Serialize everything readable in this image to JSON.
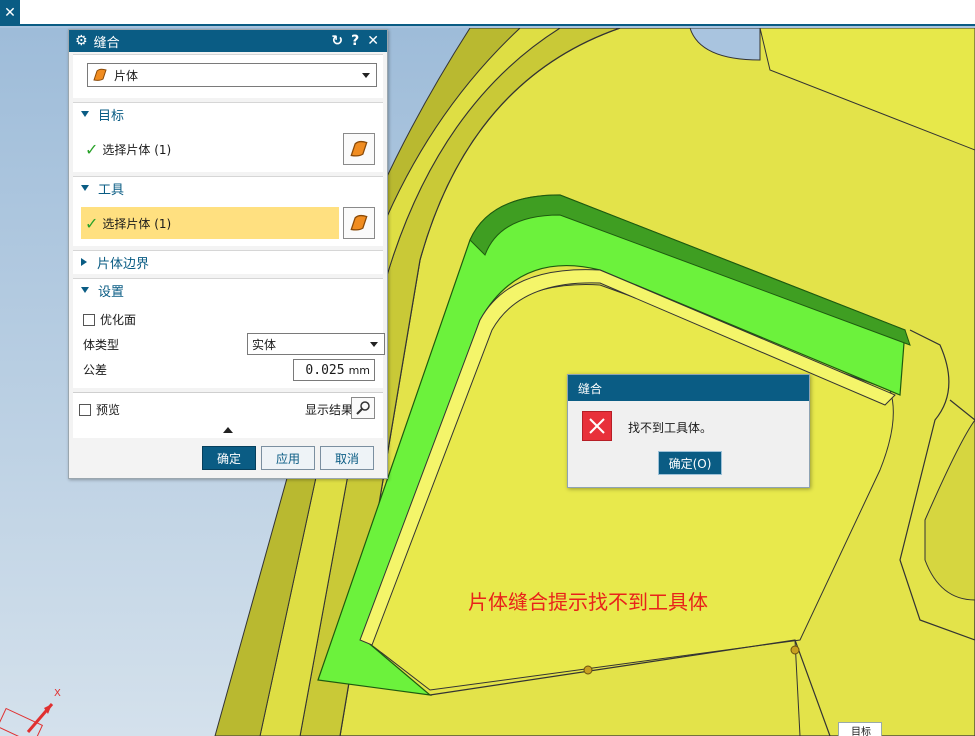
{
  "topbar": {
    "close_glyph": "✕"
  },
  "annotation": "片体缝合提示找不到工具体",
  "stitch_dialog": {
    "title": "缝合",
    "type_value": "片体",
    "target": {
      "header": "目标",
      "select_label": "选择片体 (1)"
    },
    "tool": {
      "header": "工具",
      "select_label": "选择片体 (1)"
    },
    "sheet_boundary": {
      "header": "片体边界"
    },
    "settings": {
      "header": "设置",
      "optimize_label": "优化面",
      "body_type_label": "体类型",
      "body_type_value": "实体",
      "tolerance_label": "公差",
      "tolerance_value": "0.025",
      "tolerance_unit": "mm"
    },
    "preview_label": "预览",
    "show_result_label": "显示结果",
    "buttons": {
      "ok": "确定",
      "apply": "应用",
      "cancel": "取消"
    }
  },
  "error_dialog": {
    "title": "缝合",
    "message": "找不到工具体。",
    "ok_label": "确定(O)"
  },
  "axis": {
    "x_label": "X"
  },
  "corner_label": "目标",
  "colors": {
    "titlebar": "#0a5c84",
    "highlight": "#ffe080",
    "model_yellow": "#e7e84a",
    "model_green": "#6cf23c",
    "annotation_red": "#e8231a",
    "error_red": "#e8303a"
  }
}
